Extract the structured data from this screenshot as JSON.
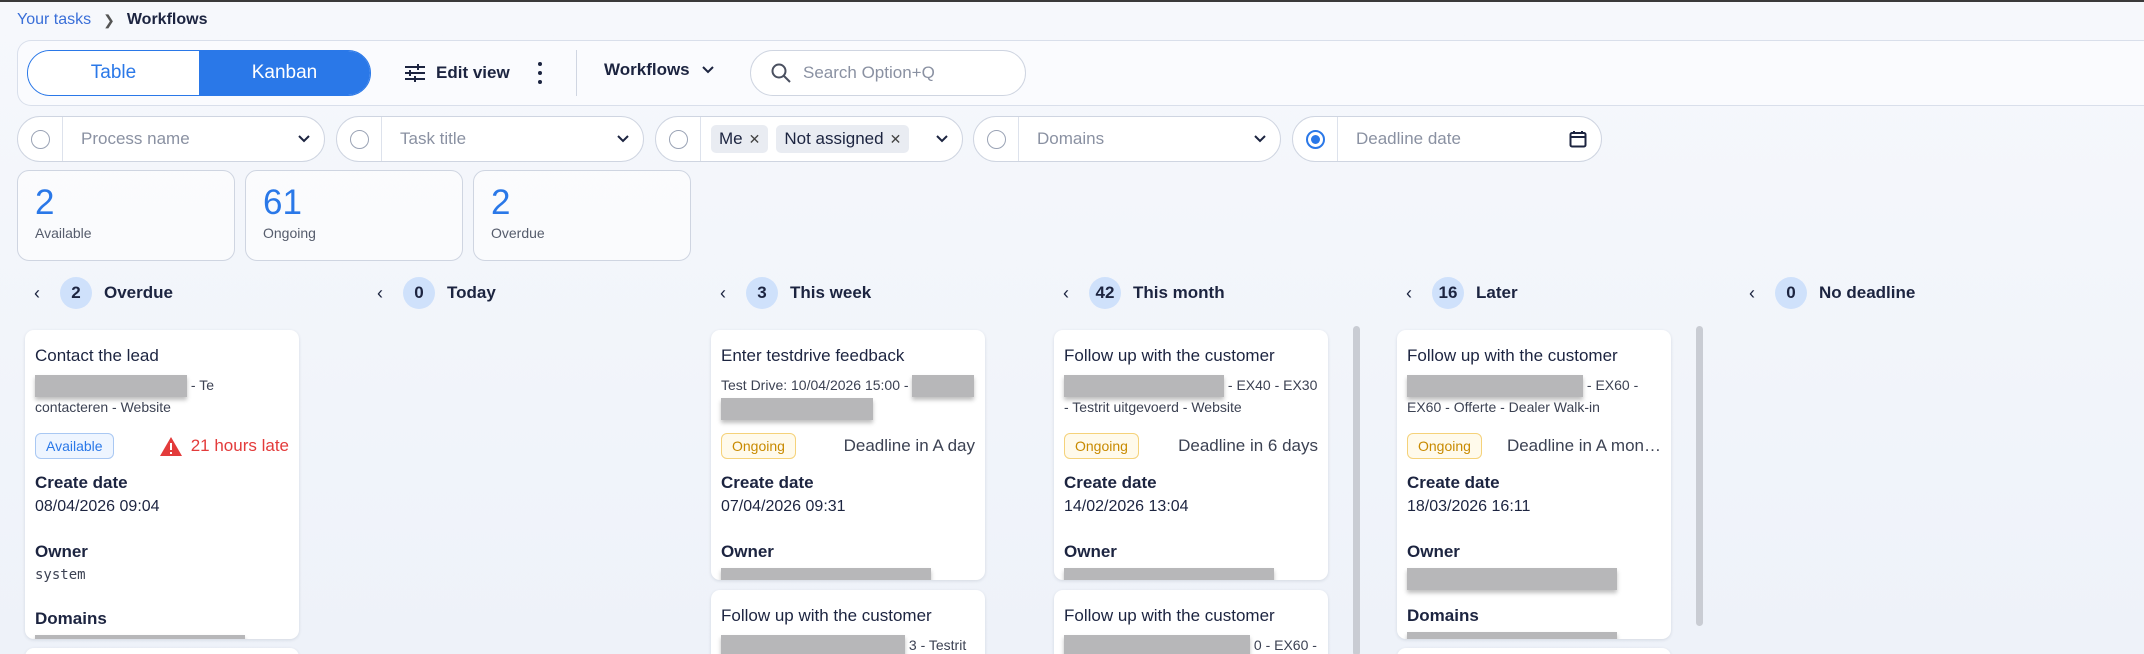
{
  "breadcrumb": {
    "parent": "Your tasks",
    "current": "Workflows"
  },
  "toolbar": {
    "view_table": "Table",
    "view_kanban": "Kanban",
    "edit_view": "Edit view",
    "workflows": "Workflows",
    "search_placeholder": "Search Option+Q"
  },
  "filters": {
    "process_name": "Process name",
    "task_title": "Task title",
    "assignee_chips": [
      "Me",
      "Not assigned"
    ],
    "domains": "Domains",
    "deadline_date": "Deadline date"
  },
  "stats": [
    {
      "value": "2",
      "label": "Available"
    },
    {
      "value": "61",
      "label": "Ongoing"
    },
    {
      "value": "2",
      "label": "Overdue"
    }
  ],
  "columns": [
    {
      "count": "2",
      "title": "Overdue"
    },
    {
      "count": "0",
      "title": "Today"
    },
    {
      "count": "3",
      "title": "This week"
    },
    {
      "count": "42",
      "title": "This month"
    },
    {
      "count": "16",
      "title": "Later"
    },
    {
      "count": "0",
      "title": "No deadline"
    }
  ],
  "labels": {
    "create_date": "Create date",
    "owner": "Owner",
    "domains": "Domains"
  },
  "cards": {
    "overdue_1": {
      "title": "Contact the lead",
      "sub_tail": "- Te",
      "sub_line2": "contacteren - Website",
      "badge": "Available",
      "late": "21 hours late",
      "create_date": "08/04/2026 09:04",
      "owner": "system"
    },
    "week_1": {
      "title": "Enter testdrive feedback",
      "sub": "Test Drive: 10/04/2026 15:00 -",
      "badge": "Ongoing",
      "deadline": "Deadline in A day",
      "create_date": "07/04/2026 09:31"
    },
    "week_2": {
      "title": "Follow up with the customer",
      "sub_tail": "3 - Testrit"
    },
    "month_1": {
      "title": "Follow up with the customer",
      "sub_tail": "- EX40 - EX30",
      "sub_line2": "- Testrit uitgevoerd - Website",
      "badge": "Ongoing",
      "deadline": "Deadline in 6 days",
      "create_date": "14/02/2026 13:04"
    },
    "month_2": {
      "title": "Follow up with the customer",
      "sub_tail": "0 - EX60 -"
    },
    "later_1": {
      "title": "Follow up with the customer",
      "sub_tail": "- EX60 -",
      "sub_line2": "EX60 - Offerte - Dealer Walk-in",
      "badge": "Ongoing",
      "deadline": "Deadline in A mon…",
      "create_date": "18/03/2026 16:11"
    }
  },
  "colors": {
    "accent": "#2a78e8",
    "late": "#e33b3b",
    "ongoing": "#c88a00"
  }
}
